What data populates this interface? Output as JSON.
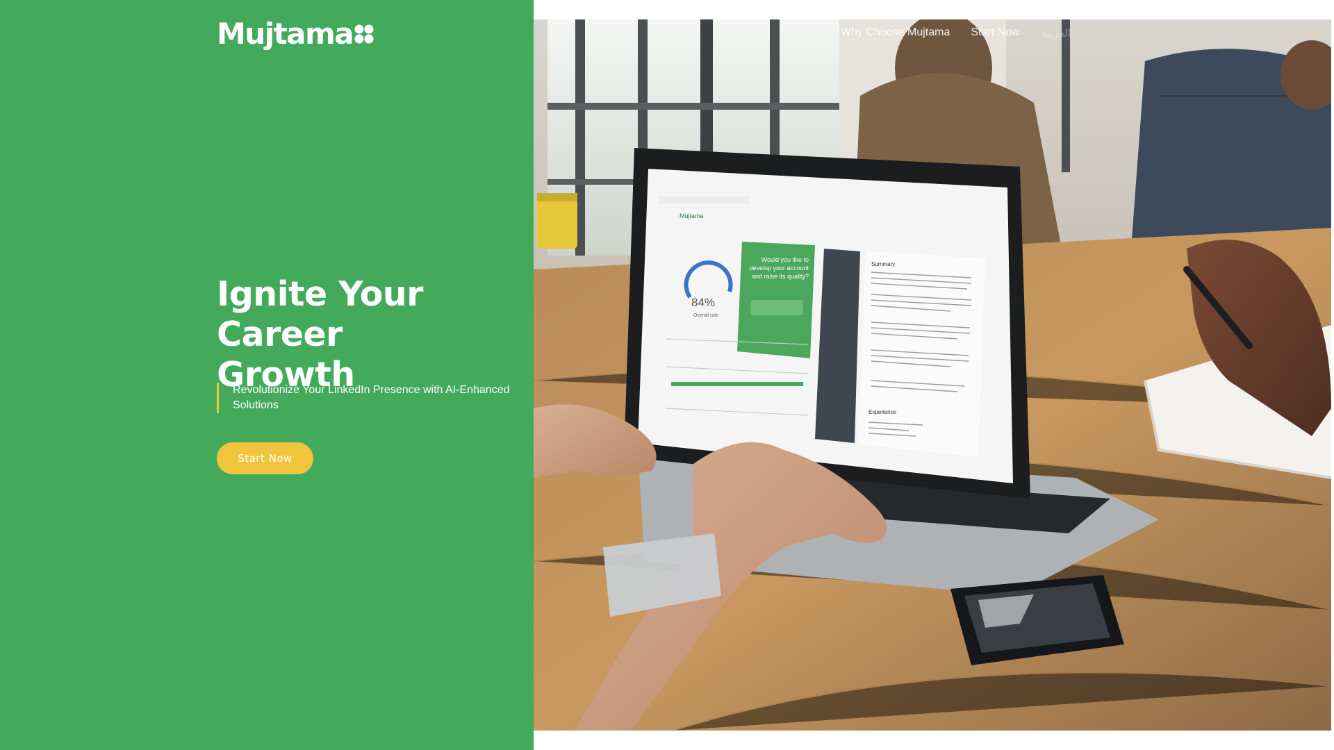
{
  "brand": {
    "name": "Mujtama"
  },
  "nav": {
    "items": [
      {
        "label": ""
      },
      {
        "label": "Why Choose Mujtama"
      },
      {
        "label": "Start Now"
      },
      {
        "label": "العربية"
      }
    ]
  },
  "hero": {
    "title_line1": "Ignite Your Career",
    "title_line2": "Growth",
    "subtitle": "Revolutionize Your LinkedIn Presence with AI-Enhanced Solutions",
    "cta_label": "Start Now"
  },
  "photo_screen": {
    "score": "84%",
    "score_caption": "Overall rate",
    "prompt": "Would you like to develop your account and raise its quality?",
    "section_summary": "Summary",
    "section_experience": "Experience",
    "app_logo": "Mujtama"
  },
  "colors": {
    "panel_green": "#43aa5c",
    "accent_yellow": "#f0c43d",
    "text_white": "#ffffff"
  }
}
